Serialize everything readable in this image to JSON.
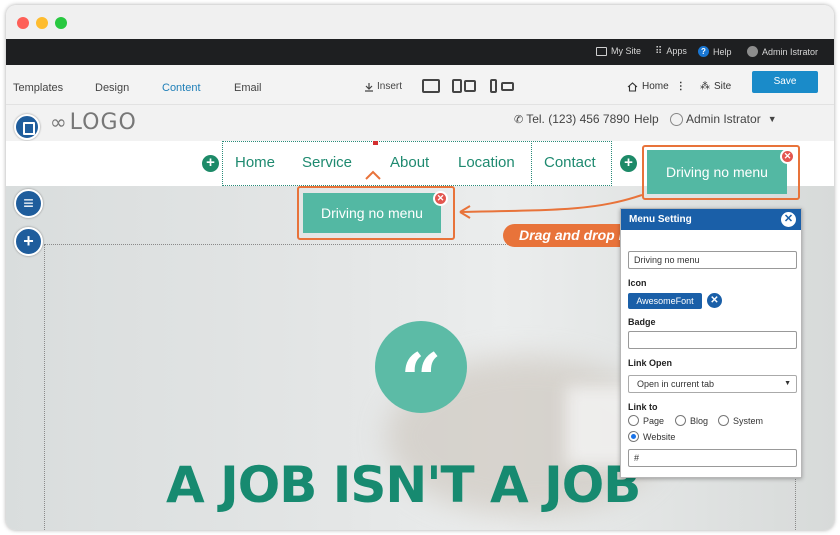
{
  "window": {
    "traffic_lights": [
      "close",
      "minimize",
      "maximize"
    ]
  },
  "admin_bar": {
    "my_site": "My Site",
    "apps": "Apps",
    "help": "Help",
    "user": "Admin Istrator"
  },
  "toolbar": {
    "tabs": [
      "Templates",
      "Design",
      "Content",
      "Email"
    ],
    "active_tab": "Content",
    "insert": "Insert",
    "home": "Home",
    "site": "Site",
    "save": "Save"
  },
  "site_bar": {
    "logo": "LOGO",
    "tel": "Tel. (123) 456 7890",
    "help": "Help",
    "user": "Admin Istrator"
  },
  "nav": {
    "items": [
      "Home",
      "Service",
      "About",
      "Location",
      "Contact"
    ]
  },
  "drag": {
    "pill_label": "Driving no menu",
    "ghost_label": "Driving no menu",
    "callout": "Drag and drop menu"
  },
  "canvas": {
    "headline": "A JOB ISN'T A JOB",
    "quote_glyph": "“"
  },
  "menu_setting": {
    "title": "Menu Setting",
    "name_value": "Driving no menu",
    "icon_label": "Icon",
    "icon_value": "AwesomeFont",
    "badge_label": "Badge",
    "badge_value": "",
    "link_open_label": "Link Open",
    "link_open_value": "Open in current tab",
    "link_to_label": "Link to",
    "link_to_options": [
      "Page",
      "Blog",
      "System",
      "Website"
    ],
    "link_to_selected": "Website",
    "url_value": "#"
  },
  "colors": {
    "accent": "#1f8a70",
    "pill": "#53b8a3",
    "callout": "#e8733a",
    "panel_header": "#1a5fa8",
    "save": "#1a8bc9"
  }
}
